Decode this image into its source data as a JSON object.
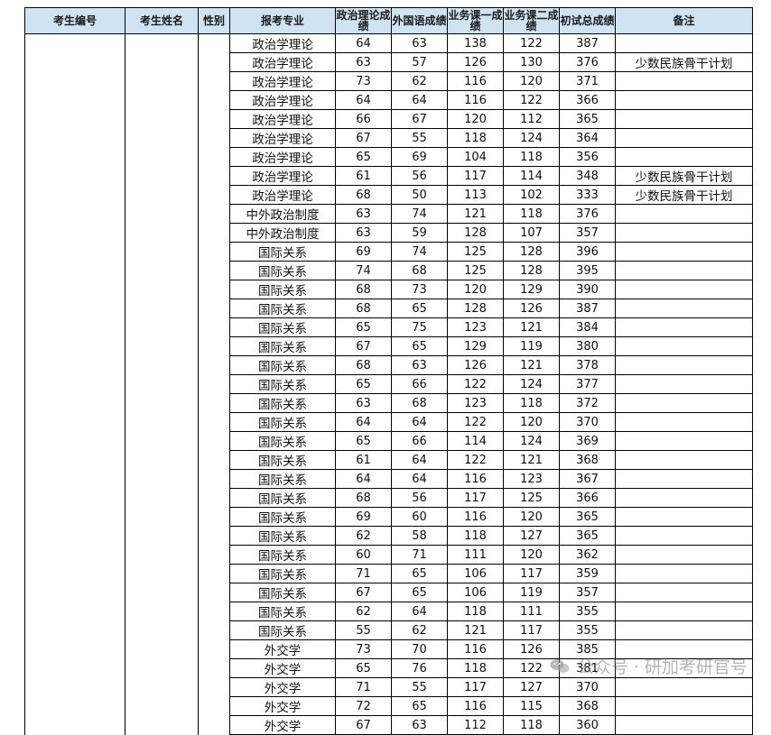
{
  "headers": [
    "考生编号",
    "考生姓名",
    "性别",
    "报考专业",
    "政治理论成绩",
    "外国语成绩",
    "业务课一成绩",
    "业务课二成绩",
    "初试总成绩",
    "备注"
  ],
  "rows": [
    {
      "major": "政治学理论",
      "politics": "64",
      "foreign": "63",
      "course1": "138",
      "course2": "122",
      "total": "387",
      "note": ""
    },
    {
      "major": "政治学理论",
      "politics": "63",
      "foreign": "57",
      "course1": "126",
      "course2": "130",
      "total": "376",
      "note": "少数民族骨干计划"
    },
    {
      "major": "政治学理论",
      "politics": "73",
      "foreign": "62",
      "course1": "116",
      "course2": "120",
      "total": "371",
      "note": ""
    },
    {
      "major": "政治学理论",
      "politics": "64",
      "foreign": "64",
      "course1": "116",
      "course2": "122",
      "total": "366",
      "note": ""
    },
    {
      "major": "政治学理论",
      "politics": "66",
      "foreign": "67",
      "course1": "120",
      "course2": "112",
      "total": "365",
      "note": ""
    },
    {
      "major": "政治学理论",
      "politics": "67",
      "foreign": "55",
      "course1": "118",
      "course2": "124",
      "total": "364",
      "note": ""
    },
    {
      "major": "政治学理论",
      "politics": "65",
      "foreign": "69",
      "course1": "104",
      "course2": "118",
      "total": "356",
      "note": ""
    },
    {
      "major": "政治学理论",
      "politics": "61",
      "foreign": "56",
      "course1": "117",
      "course2": "114",
      "total": "348",
      "note": "少数民族骨干计划"
    },
    {
      "major": "政治学理论",
      "politics": "68",
      "foreign": "50",
      "course1": "113",
      "course2": "102",
      "total": "333",
      "note": "少数民族骨干计划"
    },
    {
      "major": "中外政治制度",
      "politics": "63",
      "foreign": "74",
      "course1": "121",
      "course2": "118",
      "total": "376",
      "note": ""
    },
    {
      "major": "中外政治制度",
      "politics": "63",
      "foreign": "59",
      "course1": "128",
      "course2": "107",
      "total": "357",
      "note": ""
    },
    {
      "major": "国际关系",
      "politics": "69",
      "foreign": "74",
      "course1": "125",
      "course2": "128",
      "total": "396",
      "note": ""
    },
    {
      "major": "国际关系",
      "politics": "74",
      "foreign": "68",
      "course1": "125",
      "course2": "128",
      "total": "395",
      "note": ""
    },
    {
      "major": "国际关系",
      "politics": "68",
      "foreign": "73",
      "course1": "120",
      "course2": "129",
      "total": "390",
      "note": ""
    },
    {
      "major": "国际关系",
      "politics": "68",
      "foreign": "65",
      "course1": "128",
      "course2": "126",
      "total": "387",
      "note": ""
    },
    {
      "major": "国际关系",
      "politics": "65",
      "foreign": "75",
      "course1": "123",
      "course2": "121",
      "total": "384",
      "note": ""
    },
    {
      "major": "国际关系",
      "politics": "67",
      "foreign": "65",
      "course1": "129",
      "course2": "119",
      "total": "380",
      "note": ""
    },
    {
      "major": "国际关系",
      "politics": "68",
      "foreign": "63",
      "course1": "126",
      "course2": "121",
      "total": "378",
      "note": ""
    },
    {
      "major": "国际关系",
      "politics": "65",
      "foreign": "66",
      "course1": "122",
      "course2": "124",
      "total": "377",
      "note": ""
    },
    {
      "major": "国际关系",
      "politics": "63",
      "foreign": "68",
      "course1": "123",
      "course2": "118",
      "total": "372",
      "note": ""
    },
    {
      "major": "国际关系",
      "politics": "64",
      "foreign": "64",
      "course1": "122",
      "course2": "120",
      "total": "370",
      "note": ""
    },
    {
      "major": "国际关系",
      "politics": "65",
      "foreign": "66",
      "course1": "114",
      "course2": "124",
      "total": "369",
      "note": ""
    },
    {
      "major": "国际关系",
      "politics": "61",
      "foreign": "64",
      "course1": "122",
      "course2": "121",
      "total": "368",
      "note": ""
    },
    {
      "major": "国际关系",
      "politics": "64",
      "foreign": "64",
      "course1": "116",
      "course2": "123",
      "total": "367",
      "note": ""
    },
    {
      "major": "国际关系",
      "politics": "68",
      "foreign": "56",
      "course1": "117",
      "course2": "125",
      "total": "366",
      "note": ""
    },
    {
      "major": "国际关系",
      "politics": "69",
      "foreign": "60",
      "course1": "116",
      "course2": "120",
      "total": "365",
      "note": ""
    },
    {
      "major": "国际关系",
      "politics": "62",
      "foreign": "58",
      "course1": "118",
      "course2": "127",
      "total": "365",
      "note": ""
    },
    {
      "major": "国际关系",
      "politics": "60",
      "foreign": "71",
      "course1": "111",
      "course2": "120",
      "total": "362",
      "note": ""
    },
    {
      "major": "国际关系",
      "politics": "71",
      "foreign": "65",
      "course1": "106",
      "course2": "117",
      "total": "359",
      "note": ""
    },
    {
      "major": "国际关系",
      "politics": "67",
      "foreign": "65",
      "course1": "106",
      "course2": "119",
      "total": "357",
      "note": ""
    },
    {
      "major": "国际关系",
      "politics": "62",
      "foreign": "64",
      "course1": "118",
      "course2": "111",
      "total": "355",
      "note": ""
    },
    {
      "major": "国际关系",
      "politics": "55",
      "foreign": "62",
      "course1": "121",
      "course2": "117",
      "total": "355",
      "note": ""
    },
    {
      "major": "外交学",
      "politics": "73",
      "foreign": "70",
      "course1": "116",
      "course2": "126",
      "total": "385",
      "note": ""
    },
    {
      "major": "外交学",
      "politics": "65",
      "foreign": "76",
      "course1": "118",
      "course2": "122",
      "total": "381",
      "note": ""
    },
    {
      "major": "外交学",
      "politics": "71",
      "foreign": "55",
      "course1": "117",
      "course2": "127",
      "total": "370",
      "note": ""
    },
    {
      "major": "外交学",
      "politics": "72",
      "foreign": "65",
      "course1": "116",
      "course2": "115",
      "total": "368",
      "note": ""
    },
    {
      "major": "外交学",
      "politics": "67",
      "foreign": "63",
      "course1": "112",
      "course2": "118",
      "total": "360",
      "note": ""
    }
  ],
  "watermark": {
    "text": "公众号 · 研加考研官号",
    "icon": "wechat-icon"
  }
}
